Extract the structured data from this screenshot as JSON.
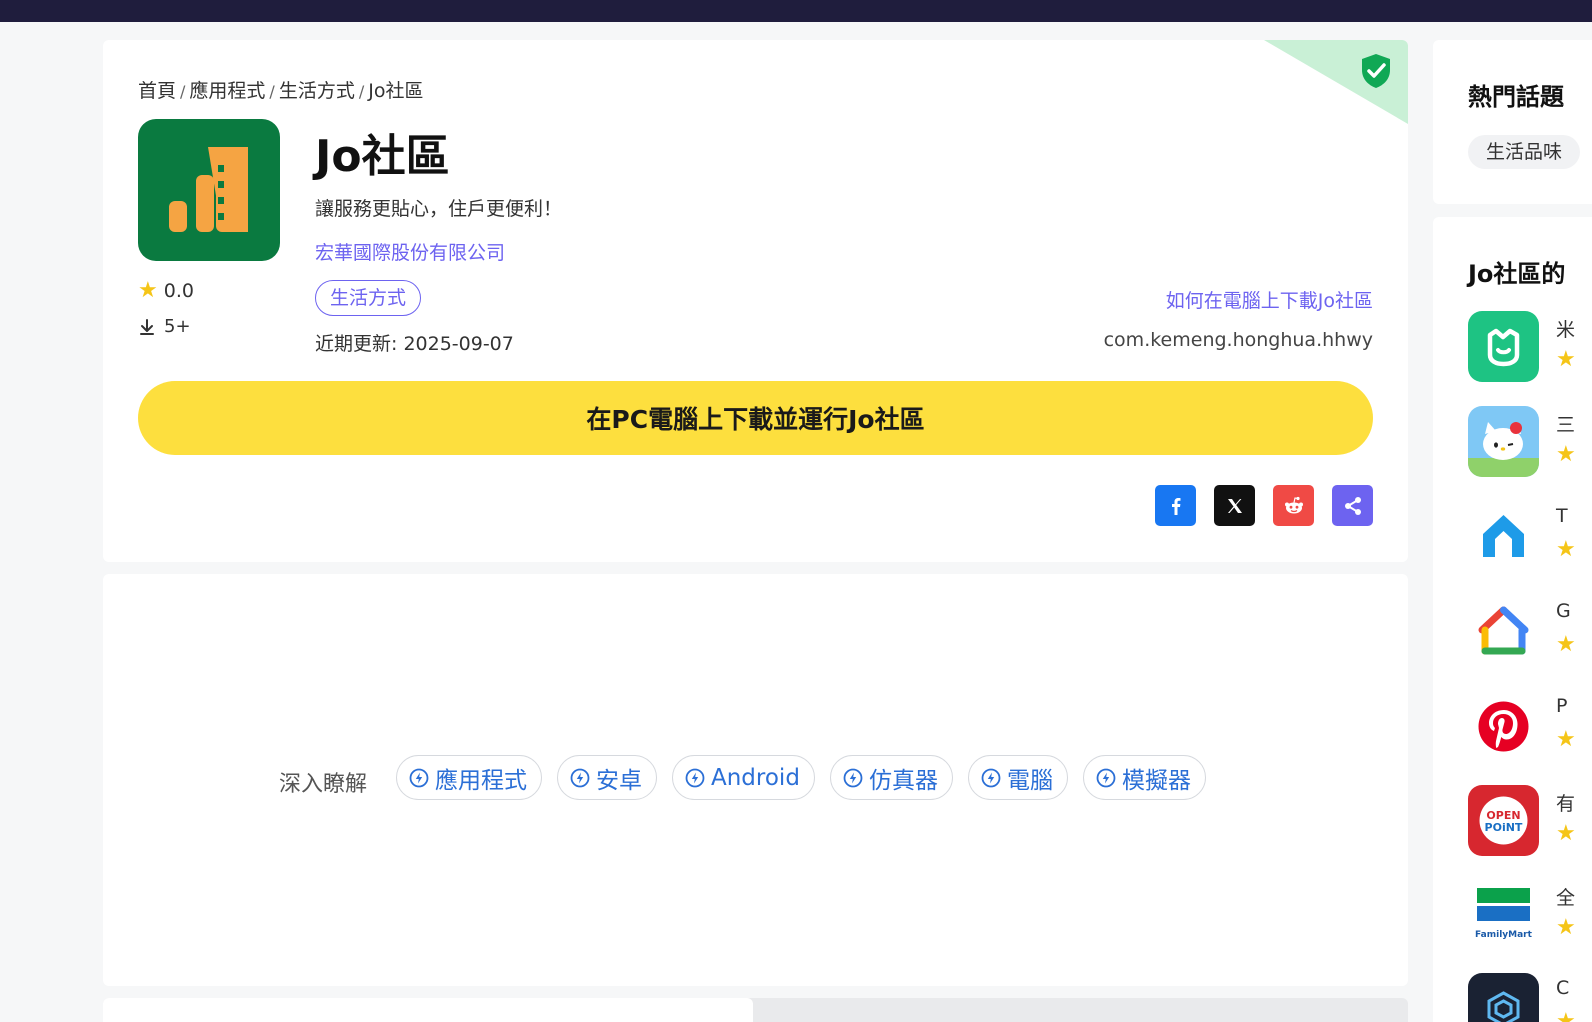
{
  "breadcrumb": {
    "home": "首頁",
    "apps": "應用程式",
    "category": "生活方式",
    "current": "Jo社區",
    "separator": "/"
  },
  "app": {
    "title": "Jo社區",
    "tagline": "讓服務更貼心，住戶更便利！",
    "developer": "宏華國際股份有限公司",
    "category_tag": "生活方式",
    "rating": "0.0",
    "installs": "5+",
    "updated": "近期更新: 2025-09-07",
    "package": "com.kemeng.honghua.hhwy",
    "how_to_link": "如何在電腦上下載Jo社區",
    "download_button": "在PC電腦上下載並運行Jo社區"
  },
  "learn_more": {
    "label": "深入瞭解",
    "pills": [
      "應用程式",
      "安卓",
      "Android",
      "仿真器",
      "電腦",
      "模擬器"
    ]
  },
  "sidebar": {
    "hot_topics_heading": "熱門話題",
    "hot_topic_pill": "生活品味",
    "related_heading": "Jo社區的",
    "related": [
      {
        "name": "米",
        "icon": "mi-home-icon"
      },
      {
        "name": "三",
        "icon": "hello-kitty-icon"
      },
      {
        "name": "T",
        "icon": "tp-link-icon"
      },
      {
        "name": "G",
        "icon": "google-home-icon"
      },
      {
        "name": "P",
        "icon": "pinterest-icon"
      },
      {
        "name": "有",
        "icon": "openpoint-icon"
      },
      {
        "name": "全",
        "icon": "familymart-icon"
      },
      {
        "name": "C",
        "icon": "cube-icon"
      }
    ]
  },
  "colors": {
    "accent": "#6d63f0",
    "download_button": "#fddf3e",
    "app_icon_bg": "#0a7a40",
    "app_icon_fg": "#f5a443",
    "topbar": "#1f1d3d",
    "star": "#f5c518"
  }
}
